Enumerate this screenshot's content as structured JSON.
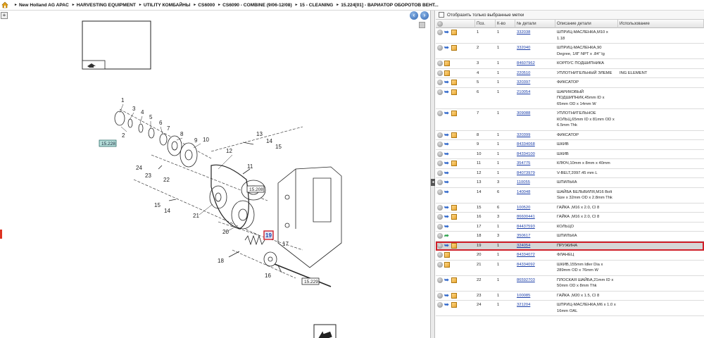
{
  "breadcrumb": [
    "New Holland AG APAC",
    "HARVESTING EQUIPMENT",
    "UTILITY КОМБАЙНЫ",
    "CS6000",
    "CS6090 - COMBINE (9/06-12/08)",
    "15 - CLEANING",
    "15.224[01] - ВАРИАТОР ОБОРОТОВ ВЕНТ..."
  ],
  "filter_label": "Отобразить только выбранные метки",
  "columns": {
    "pos": "Поз.",
    "qty": "К-во",
    "num": "№ детали",
    "desc": "Описание детали",
    "use": "Использование"
  },
  "rows": [
    {
      "pos": "1",
      "qty": "1",
      "num": "332038",
      "desc": "ШПРИЦ-МАСЛЕНКА,M10 x 1.18",
      "use": "",
      "icons": [
        "g",
        "b",
        "c"
      ]
    },
    {
      "pos": "2",
      "qty": "1",
      "num": "332040",
      "desc": "ШПРИЦ-МАСЛЕНКА,90 Degree, 1/8\" NPT x .84\" lg",
      "use": "",
      "icons": [
        "g",
        "b",
        "c"
      ]
    },
    {
      "pos": "3",
      "qty": "1",
      "num": "84607962",
      "desc": "КОРПУС ПОДШИПНИКА",
      "use": "",
      "icons": [
        "g",
        "c"
      ]
    },
    {
      "pos": "4",
      "qty": "1",
      "num": "220510",
      "desc": "УПЛОТНИТЕЛЬНЫЙ ЭЛЕМЕ",
      "use": "ING ELEMENT",
      "icons": [
        "g",
        "c"
      ]
    },
    {
      "pos": "5",
      "qty": "1",
      "num": "320397",
      "desc": "ФИКСАТОР",
      "use": "",
      "icons": [
        "g",
        "b",
        "c"
      ]
    },
    {
      "pos": "6",
      "qty": "1",
      "num": "210054",
      "desc": "ШАРИКОВЫЙ ПОДШИПНИК,45mm ID x 65mm OD x 14mm W",
      "use": "",
      "icons": [
        "g",
        "b",
        "c"
      ]
    },
    {
      "pos": "7",
      "qty": "1",
      "num": "309088",
      "desc": "УПЛОТНИТЕЛЬНОЕ КОЛЬЦ,65mm ID x 81mm OD x 6.5mm Thk",
      "use": "",
      "icons": [
        "g",
        "b",
        "c"
      ]
    },
    {
      "pos": "8",
      "qty": "1",
      "num": "320399",
      "desc": "ФИКСАТОР",
      "use": "",
      "icons": [
        "g",
        "b",
        "c"
      ]
    },
    {
      "pos": "9",
      "qty": "1",
      "num": "84334068",
      "desc": "ШКИВ",
      "use": "",
      "icons": [
        "g",
        "b"
      ]
    },
    {
      "pos": "10",
      "qty": "1",
      "num": "84334100",
      "desc": "ШКИВ",
      "use": "",
      "icons": [
        "g",
        "b"
      ]
    },
    {
      "pos": "11",
      "qty": "1",
      "num": "354775",
      "desc": "КЛЮЧ,10mm x 8mm x 40mm",
      "use": "",
      "icons": [
        "g",
        "b",
        "c"
      ]
    },
    {
      "pos": "12",
      "qty": "1",
      "num": "84073979",
      "desc": "V-BELT,2097.45 mm L",
      "use": "",
      "icons": [
        "g",
        "b"
      ]
    },
    {
      "pos": "13",
      "qty": "3",
      "num": "110055",
      "desc": "ШПИЛЬКА",
      "use": "",
      "icons": [
        "g",
        "b"
      ]
    },
    {
      "pos": "14",
      "qty": "6",
      "num": "140048",
      "desc": "ШАЙБА БЕЛЬВИЛЯ,M16 Bolt Size x 32mm OD x 2.8mm Thk",
      "use": "",
      "icons": [
        "g",
        "b"
      ]
    },
    {
      "pos": "15",
      "qty": "6",
      "num": "100520",
      "desc": "ГАЙКА ,M16 x 2.0, Cl 8",
      "use": "",
      "icons": [
        "g",
        "b",
        "c"
      ]
    },
    {
      "pos": "16",
      "qty": "3",
      "num": "86600441",
      "desc": "ГАЙКА ,M16 x 2.0, Cl 8",
      "use": "",
      "icons": [
        "g",
        "b",
        "c"
      ]
    },
    {
      "pos": "17",
      "qty": "1",
      "num": "84437593",
      "desc": "КОЛЬЦО",
      "use": "",
      "icons": [
        "g",
        "b"
      ]
    },
    {
      "pos": "18",
      "qty": "3",
      "num": "350617",
      "desc": "ШПИЛЬКА",
      "use": "",
      "icons": [
        "g",
        "gr"
      ]
    },
    {
      "pos": "19",
      "qty": "1",
      "num": "324054",
      "desc": "ПРУЖИНА",
      "use": "",
      "icons": [
        "g",
        "b",
        "c"
      ],
      "selected": true
    },
    {
      "pos": "20",
      "qty": "1",
      "num": "84334072",
      "desc": "ФЛАНЕЦ",
      "use": "",
      "icons": [
        "g",
        "c"
      ]
    },
    {
      "pos": "21",
      "qty": "1",
      "num": "84334092",
      "desc": "ШКИВ,155mm Idler Dia x 289mm OD x 76mm W",
      "use": "",
      "icons": [
        "g",
        "c"
      ]
    },
    {
      "pos": "22",
      "qty": "1",
      "num": "86592703",
      "desc": "ПЛОСКАЯ ШАЙБА,21mm ID x 50mm OD x 8mm Thk",
      "use": "",
      "icons": [
        "g",
        "b",
        "c"
      ]
    },
    {
      "pos": "23",
      "qty": "1",
      "num": "100085",
      "desc": "ГАЙКА ,M20 x 1.5, Cl 8",
      "use": "",
      "icons": [
        "g",
        "b",
        "c"
      ]
    },
    {
      "pos": "24",
      "qty": "1",
      "num": "321204",
      "desc": "ШПРИЦ-МАСЛЕНКА,M6 x 1.0 x 16mm OAL",
      "use": "",
      "icons": [
        "g",
        "b",
        "c"
      ]
    }
  ],
  "diagram": {
    "callouts": [
      "1",
      "2",
      "3",
      "4",
      "5",
      "6",
      "7",
      "8",
      "9",
      "10",
      "11",
      "12",
      "13",
      "14",
      "15",
      "16",
      "17",
      "18",
      "19",
      "20",
      "21",
      "22",
      "23",
      "24",
      "15",
      "14"
    ],
    "refs": [
      "15.228",
      "15.208",
      "15.229"
    ],
    "highlight": "19"
  },
  "colors": {
    "link": "#1a3da8",
    "highlight": "#d0202a",
    "selected_bg": "#d6d6d6"
  }
}
